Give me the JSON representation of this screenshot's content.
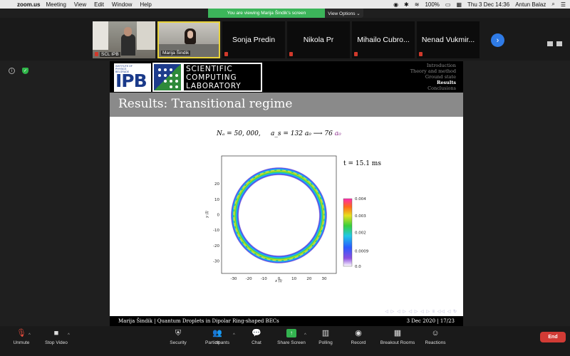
{
  "menubar": {
    "app": "zoom.us",
    "items": [
      "Meeting",
      "View",
      "Edit",
      "Window",
      "Help"
    ],
    "battery": "100%",
    "datetime": "Thu 3 Dec  14:36",
    "user": "Antun Balaz"
  },
  "banner": {
    "sharing": "You are viewing Marija Šindik's screen",
    "view_options": "View Options ⌄"
  },
  "participants": [
    {
      "name": "SCL IPB"
    },
    {
      "name": "Marija Šindik"
    },
    {
      "name": "Sonja Predin"
    },
    {
      "name": "Nikola Pr"
    },
    {
      "name": "Mihailo Cubro..."
    },
    {
      "name": "Nenad Vukmir..."
    }
  ],
  "slide": {
    "ipb_small": "INSTITUTE OF PHYSICS BELGRADE",
    "ipb_big": "IPB",
    "scl_line1": "SCIENTIFIC",
    "scl_line2": "COMPUTING",
    "scl_line3": "LABORATORY",
    "nav": [
      "Introduction",
      "Theory and method",
      "Ground state",
      "Results",
      "Conclusions"
    ],
    "title": "Results: Transitional regime",
    "equation_left": "Nₐ = 50, 000,",
    "equation_mid": "a_s = 132 a₀ ⟶ 76",
    "equation_right": "a₀",
    "time": "t = 15.1 ms",
    "footer_left": "Marija Šindik  |  Quantum Droplets in Dipolar Ring-shaped BECs",
    "footer_right": "3 Dec 2020  |  17/23",
    "beamer_nav": "◁ ▷ ◁ ▷ ◁ ▷ ◁ ▷ ≡ ◁◁ ◁ ↻"
  },
  "chart_data": {
    "type": "heatmap",
    "title": "",
    "xlabel": "x (l)",
    "ylabel": "y (l)",
    "xlim": [
      -38,
      38
    ],
    "ylim": [
      -38,
      38
    ],
    "x_ticks": [
      -30,
      -20,
      -10,
      0,
      10,
      20,
      30
    ],
    "y_ticks": [
      -30,
      -20,
      -10,
      0,
      10,
      20
    ],
    "colorbar_ticks": [
      "0.004",
      "0.003",
      "0.002",
      "0.0009",
      "0.0"
    ],
    "colorbar_values": [
      0.004,
      0.003,
      0.002,
      0.0009,
      0.0
    ],
    "ring_radius": 30,
    "ring_width": 2.2,
    "peak_density": 0.004
  },
  "toolbar": {
    "unmute": "Unmute",
    "stop_video": "Stop Video",
    "security": "Security",
    "participants": "Participants",
    "participants_count": "28",
    "chat": "Chat",
    "share": "Share Screen",
    "polling": "Polling",
    "record": "Record",
    "breakout": "Breakout Rooms",
    "reactions": "Reactions",
    "end": "End"
  }
}
